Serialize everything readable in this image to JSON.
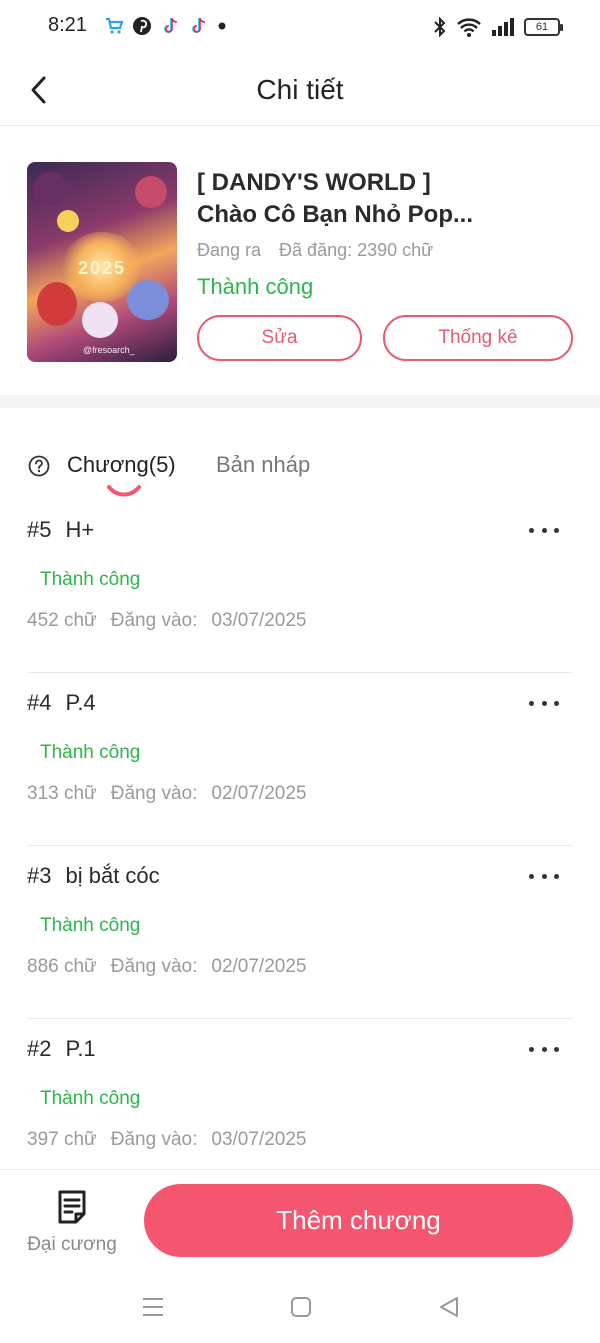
{
  "status_bar": {
    "time": "8:21",
    "battery": "61",
    "notification_icons": [
      "shopping-cart-icon",
      "pinterest-icon",
      "tiktok-icon",
      "tiktok-icon",
      "dot-icon"
    ],
    "system_icons": [
      "bluetooth-icon",
      "wifi-icon",
      "signal-icon",
      "battery-icon"
    ]
  },
  "header": {
    "title": "Chi tiết"
  },
  "story": {
    "title_line1": "[ DANDY'S WORLD ]",
    "title_line2": "Chào Cô Bạn Nhỏ Pop...",
    "state": "Đang ra",
    "posted": "Đã đăng: 2390 chữ",
    "status": "Thành công",
    "edit_label": "Sửa",
    "stats_label": "Thống kê",
    "cover": {
      "year": "2025",
      "credit": "@fresoarch_"
    }
  },
  "tabs": {
    "chapters_label": "Chương(5)",
    "drafts_label": "Bản nháp"
  },
  "chapters": [
    {
      "number": "#5",
      "title": "H+",
      "status": "Thành công",
      "words": "452 chữ",
      "posted_label": "Đăng vào:",
      "date": "03/07/2025"
    },
    {
      "number": "#4",
      "title": "P.4",
      "status": "Thành công",
      "words": "313 chữ",
      "posted_label": "Đăng vào:",
      "date": "02/07/2025"
    },
    {
      "number": "#3",
      "title": "bị bắt cóc",
      "status": "Thành công",
      "words": "886 chữ",
      "posted_label": "Đăng vào:",
      "date": "02/07/2025"
    },
    {
      "number": "#2",
      "title": "P.1",
      "status": "Thành công",
      "words": "397 chữ",
      "posted_label": "Đăng vào:",
      "date": "03/07/2025"
    }
  ],
  "bottom": {
    "outline_label": "Đại cương",
    "add_chapter_label": "Thêm chương"
  },
  "colors": {
    "accent": "#f4566f",
    "outline_accent": "#e85a73",
    "success": "#2db64b",
    "muted": "#9a9a9a"
  }
}
